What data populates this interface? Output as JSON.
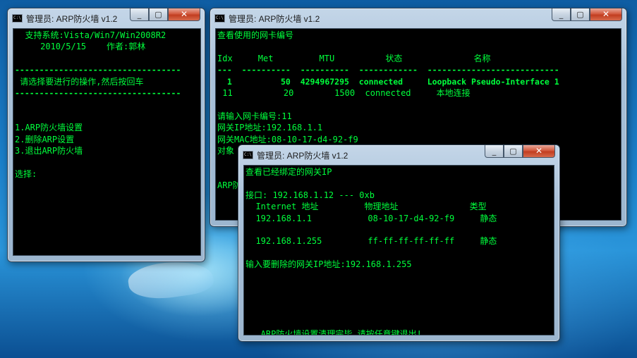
{
  "window_title": "管理员:  ARP防火墙 v1.2",
  "cmd_icon_text": "C:\\",
  "icons": {
    "minimize": "minimize-icon",
    "maximize": "maximize-icon",
    "close": "close-icon"
  },
  "colors": {
    "console_text": "#00ff3c",
    "console_bg": "#000000",
    "close_button": "#c94a2e"
  },
  "window1": {
    "lines": [
      "  支持系统:Vista/Win7/Win2008R2",
      "     2010/5/15    作者:郭林",
      "",
      "----------------------------------",
      " 请选择要进行的操作,然后按回车",
      "----------------------------------",
      "",
      "",
      "1.ARP防火墙设置",
      "2.删除ARP设置",
      "3.退出ARP防火墙",
      "",
      "选择:"
    ]
  },
  "window2": {
    "lines": [
      "查看使用的网卡编号",
      "",
      "Idx     Met         MTU          状态              名称",
      "---  ----------  ----------  ------------  ---------------------------",
      "  1          50  4294967295  connected     Loopback Pseudo-Interface 1",
      " 11          20        1500  connected     本地连接",
      "",
      "请输入网卡编号:11",
      "网关IP地址:192.168.1.1",
      "网关MAC地址:08-10-17-d4-92-f9",
      "对象",
      "",
      "",
      "ARP防"
    ]
  },
  "window3": {
    "lines": [
      "查看已经绑定的网关IP",
      "",
      "接口: 192.168.1.12 --- 0xb",
      "  Internet 地址         物理地址              类型",
      "  192.168.1.1           08-10-17-d4-92-f9     静态",
      "",
      "  192.168.1.255         ff-ff-ff-ff-ff-ff     静态",
      "",
      "输入要删除的网关IP地址:192.168.1.255",
      "",
      "",
      "",
      "",
      "",
      "   ARP防火墙设置清理完毕,请按任意键退出!"
    ]
  }
}
